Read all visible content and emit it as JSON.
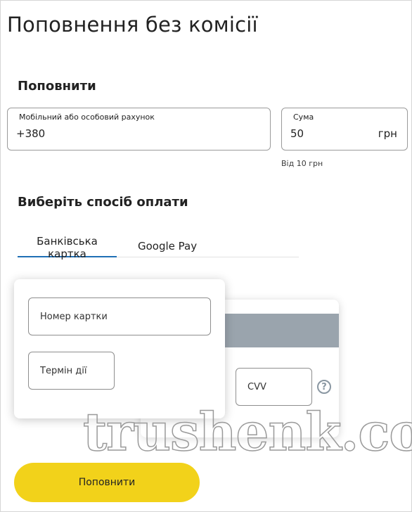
{
  "page": {
    "title": "Поповнення без комісії"
  },
  "topup": {
    "section_title": "Поповнити",
    "account_field": {
      "label": "Мобільний або особовий рахунок",
      "value": "+380"
    },
    "amount_field": {
      "label": "Сума",
      "value": "50",
      "currency": "грн",
      "hint": "Від 10 грн"
    }
  },
  "payment": {
    "section_title": "Виберіть спосіб оплати",
    "tabs": [
      {
        "label": "Банківська картка",
        "active": true
      },
      {
        "label": "Google Pay",
        "active": false
      }
    ],
    "card": {
      "number_placeholder": "Номер картки",
      "expiry_placeholder": "Термін дії",
      "cvv_placeholder": "CVV",
      "help_icon": "question-circle-icon"
    }
  },
  "submit": {
    "label": "Поповнити"
  },
  "watermark": {
    "text": "trushenk.com"
  },
  "colors": {
    "accent": "#1f6fb5",
    "button": "#f2d21a",
    "card_stripe": "#9aa4ad"
  }
}
